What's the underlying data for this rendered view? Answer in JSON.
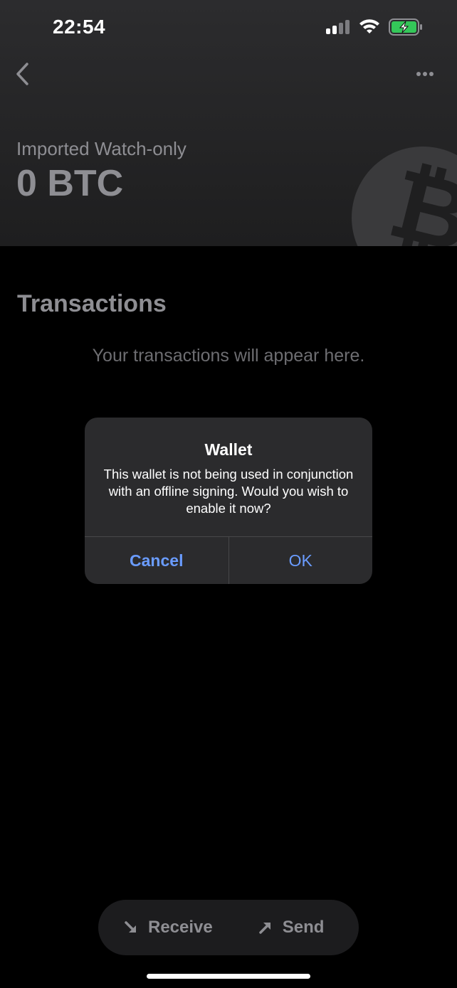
{
  "status_bar": {
    "time": "22:54"
  },
  "header": {
    "wallet_label": "Imported Watch-only",
    "balance": "0 BTC",
    "watermark_symbol": "₿"
  },
  "transactions": {
    "title": "Transactions",
    "empty_message": "Your transactions will appear here."
  },
  "alert": {
    "title": "Wallet",
    "message": "This wallet is not being used in conjunction with an offline signing. Would you wish to enable it now?",
    "cancel_label": "Cancel",
    "ok_label": "OK"
  },
  "actions": {
    "receive_label": "Receive",
    "send_label": "Send"
  },
  "colors": {
    "accent": "#6a9cff",
    "battery": "#34c759"
  }
}
